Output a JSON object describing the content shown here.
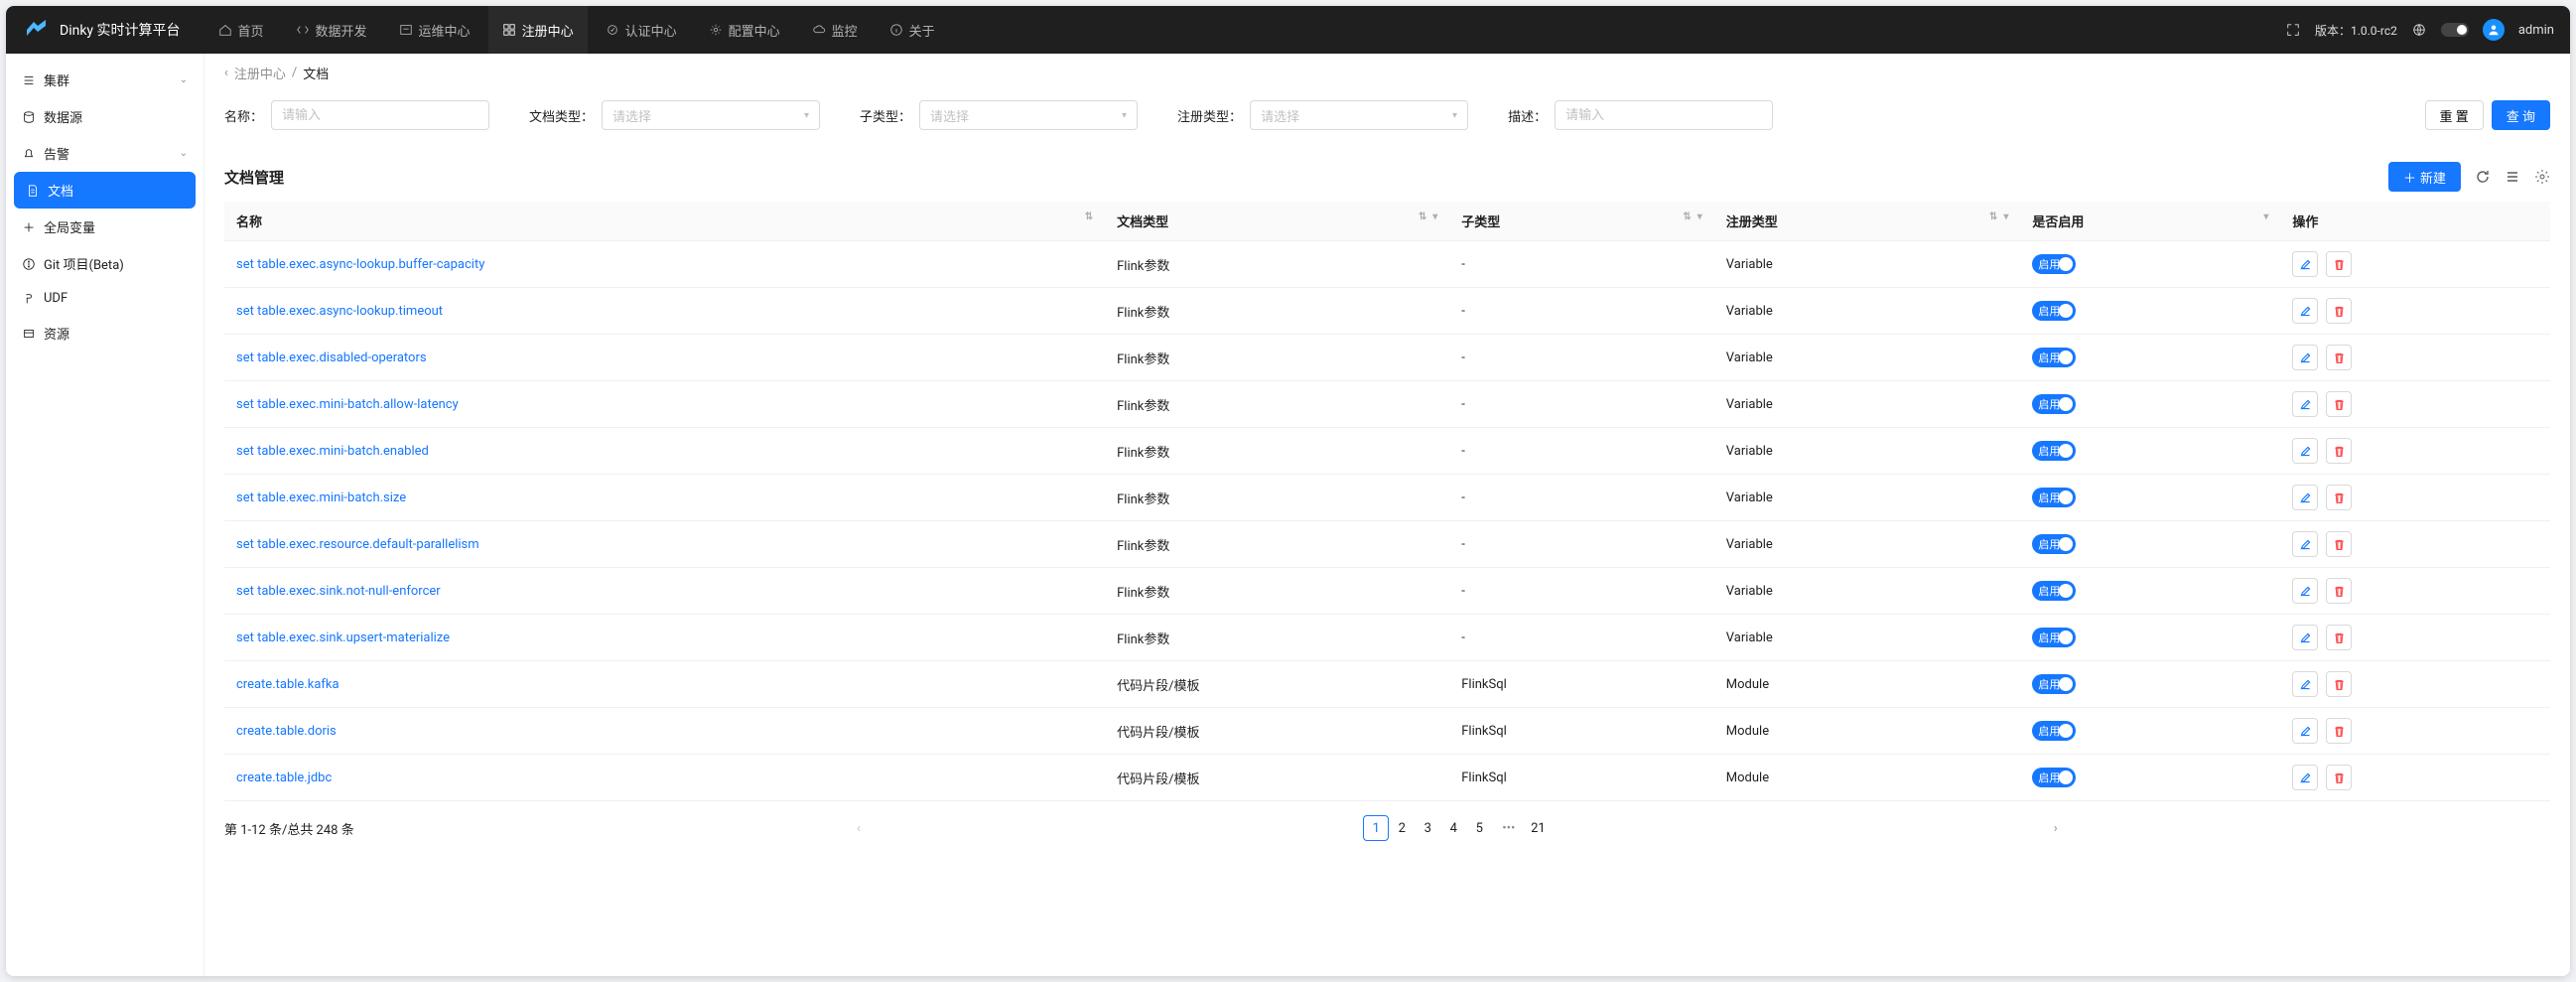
{
  "brand": "Dinky 实时计算平台",
  "topnav": [
    {
      "label": "首页",
      "icon": "home"
    },
    {
      "label": "数据开发",
      "icon": "code"
    },
    {
      "label": "运维中心",
      "icon": "ops"
    },
    {
      "label": "注册中心",
      "icon": "reg",
      "active": true
    },
    {
      "label": "认证中心",
      "icon": "auth"
    },
    {
      "label": "配置中心",
      "icon": "gear"
    },
    {
      "label": "监控",
      "icon": "cloud"
    },
    {
      "label": "关于",
      "icon": "info"
    }
  ],
  "version": "版本：1.0.0-rc2",
  "user": "admin",
  "sidebar": [
    {
      "label": "集群",
      "icon": "cluster",
      "expandable": true
    },
    {
      "label": "数据源",
      "icon": "db"
    },
    {
      "label": "告警",
      "icon": "bell",
      "expandable": true
    },
    {
      "label": "文档",
      "icon": "doc",
      "active": true
    },
    {
      "label": "全局变量",
      "icon": "var"
    },
    {
      "label": "Git 项目(Beta)",
      "icon": "git"
    },
    {
      "label": "UDF",
      "icon": "fn"
    },
    {
      "label": "资源",
      "icon": "res"
    }
  ],
  "breadcrumb": {
    "parent": "注册中心",
    "current": "文档"
  },
  "filters": {
    "name_label": "名称：",
    "name_ph": "请输入",
    "doctype_label": "文档类型：",
    "doctype_ph": "请选择",
    "subtype_label": "子类型：",
    "subtype_ph": "请选择",
    "regtype_label": "注册类型：",
    "regtype_ph": "请选择",
    "desc_label": "描述：",
    "desc_ph": "请输入",
    "reset": "重 置",
    "query": "查 询"
  },
  "section": {
    "title": "文档管理",
    "create": "新建"
  },
  "columns": {
    "name": "名称",
    "doctype": "文档类型",
    "subtype": "子类型",
    "regtype": "注册类型",
    "enabled": "是否启用",
    "action": "操作"
  },
  "switch_label": "启用",
  "rows": [
    {
      "name": "set table.exec.async-lookup.buffer-capacity",
      "doctype": "Flink参数",
      "subtype": "-",
      "regtype": "Variable"
    },
    {
      "name": "set table.exec.async-lookup.timeout",
      "doctype": "Flink参数",
      "subtype": "-",
      "regtype": "Variable"
    },
    {
      "name": "set table.exec.disabled-operators",
      "doctype": "Flink参数",
      "subtype": "-",
      "regtype": "Variable"
    },
    {
      "name": "set table.exec.mini-batch.allow-latency",
      "doctype": "Flink参数",
      "subtype": "-",
      "regtype": "Variable"
    },
    {
      "name": "set table.exec.mini-batch.enabled",
      "doctype": "Flink参数",
      "subtype": "-",
      "regtype": "Variable"
    },
    {
      "name": "set table.exec.mini-batch.size",
      "doctype": "Flink参数",
      "subtype": "-",
      "regtype": "Variable"
    },
    {
      "name": "set table.exec.resource.default-parallelism",
      "doctype": "Flink参数",
      "subtype": "-",
      "regtype": "Variable"
    },
    {
      "name": "set table.exec.sink.not-null-enforcer",
      "doctype": "Flink参数",
      "subtype": "-",
      "regtype": "Variable"
    },
    {
      "name": "set table.exec.sink.upsert-materialize",
      "doctype": "Flink参数",
      "subtype": "-",
      "regtype": "Variable"
    },
    {
      "name": "create.table.kafka",
      "doctype": "代码片段/模板",
      "subtype": "FlinkSql",
      "regtype": "Module"
    },
    {
      "name": "create.table.doris",
      "doctype": "代码片段/模板",
      "subtype": "FlinkSql",
      "regtype": "Module"
    },
    {
      "name": "create.table.jdbc",
      "doctype": "代码片段/模板",
      "subtype": "FlinkSql",
      "regtype": "Module"
    }
  ],
  "pagination": {
    "summary": "第 1-12 条/总共 248 条",
    "pages": [
      "1",
      "2",
      "3",
      "4",
      "5"
    ],
    "last": "21",
    "current": 1
  }
}
